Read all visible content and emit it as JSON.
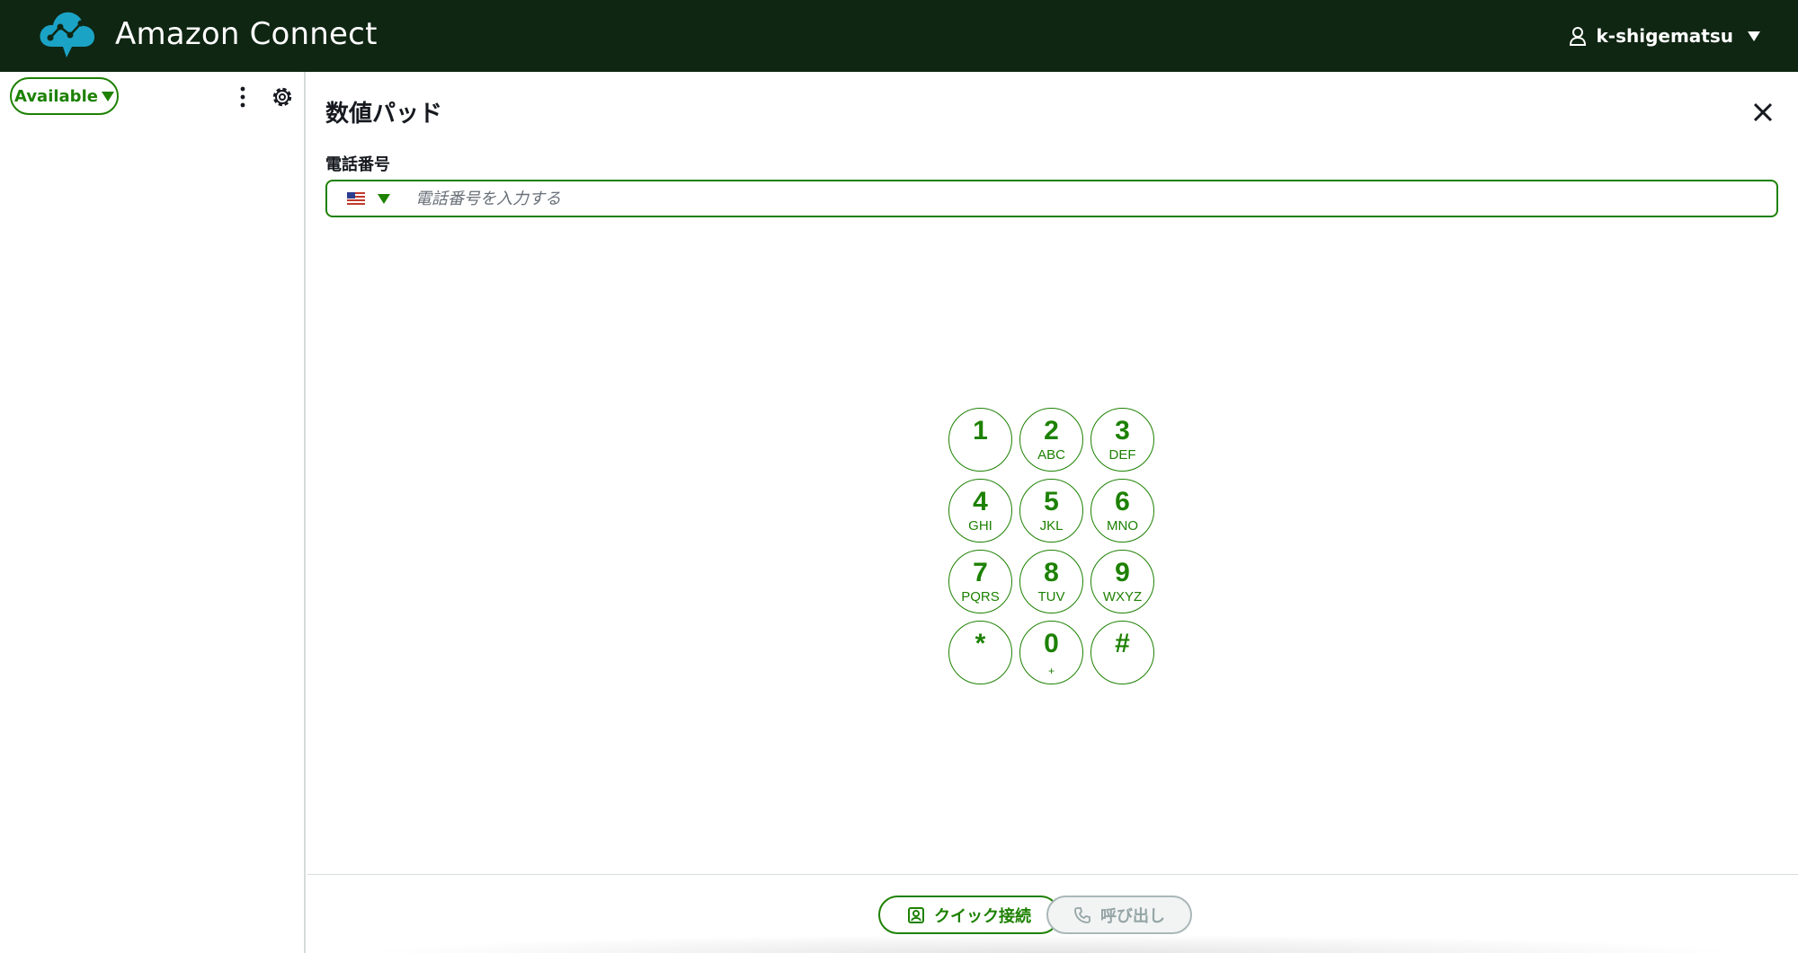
{
  "header": {
    "app_title": "Amazon Connect",
    "user_name": "k-shigematsu",
    "icons": {
      "logo": "amazon-connect-cloud-logo",
      "user": "user-icon",
      "menu_caret": "caret-down-icon"
    },
    "background_color": "#0f2612"
  },
  "sidebar": {
    "status_label": "Available",
    "icons": {
      "status_caret": "caret-down-icon",
      "more": "vertical-dots-icon",
      "settings": "gear-icon"
    }
  },
  "panel": {
    "title": "数値パッド",
    "phone_label": "電話番号",
    "phone_value": "",
    "phone_placeholder": "電話番号を入力する",
    "country_flag": "us-flag-icon",
    "keys": [
      {
        "digit": "1",
        "letters": ""
      },
      {
        "digit": "2",
        "letters": "ABC"
      },
      {
        "digit": "3",
        "letters": "DEF"
      },
      {
        "digit": "4",
        "letters": "GHI"
      },
      {
        "digit": "5",
        "letters": "JKL"
      },
      {
        "digit": "6",
        "letters": "MNO"
      },
      {
        "digit": "7",
        "letters": "PQRS"
      },
      {
        "digit": "8",
        "letters": "TUV"
      },
      {
        "digit": "9",
        "letters": "WXYZ"
      },
      {
        "digit": "*",
        "letters": ""
      },
      {
        "digit": "0",
        "letters": "+"
      },
      {
        "digit": "#",
        "letters": ""
      }
    ]
  },
  "footer": {
    "quick_connect_label": "クイック接続",
    "call_label": "呼び出し",
    "icons": {
      "quick_connect": "contact-card-icon",
      "call": "phone-icon"
    }
  },
  "colors": {
    "accent": "#1d8102",
    "disabled": "#95a5a6",
    "border": "#d5dbdb"
  }
}
